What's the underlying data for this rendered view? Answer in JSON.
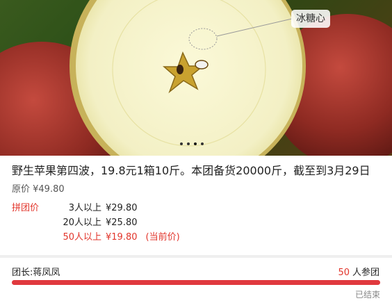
{
  "hero": {
    "badge": "冰糖心",
    "slide_index": 3,
    "slide_count": 4
  },
  "product": {
    "title": "野生苹果第四波，19.8元1箱10斤。本团备货20000斤，截至到3月29日",
    "original_price": "原价 ¥49.80",
    "group_label": "拼团价",
    "tiers": [
      {
        "count": "3人以上",
        "price": "¥29.80",
        "note": ""
      },
      {
        "count": "20人以上",
        "price": "¥25.80",
        "note": ""
      },
      {
        "count": "50人以上",
        "price": "¥19.80",
        "note": "(当前价)"
      }
    ]
  },
  "leader": {
    "name": "团长:蒋凤凤",
    "joined_count": "50",
    "joined_label": "人参团",
    "progress_fraction": 1.0,
    "status": "已结束"
  },
  "colors": {
    "accent": "#e2352b",
    "bar_track": "#f1c6c6",
    "bar_fill": "#e0393e"
  }
}
